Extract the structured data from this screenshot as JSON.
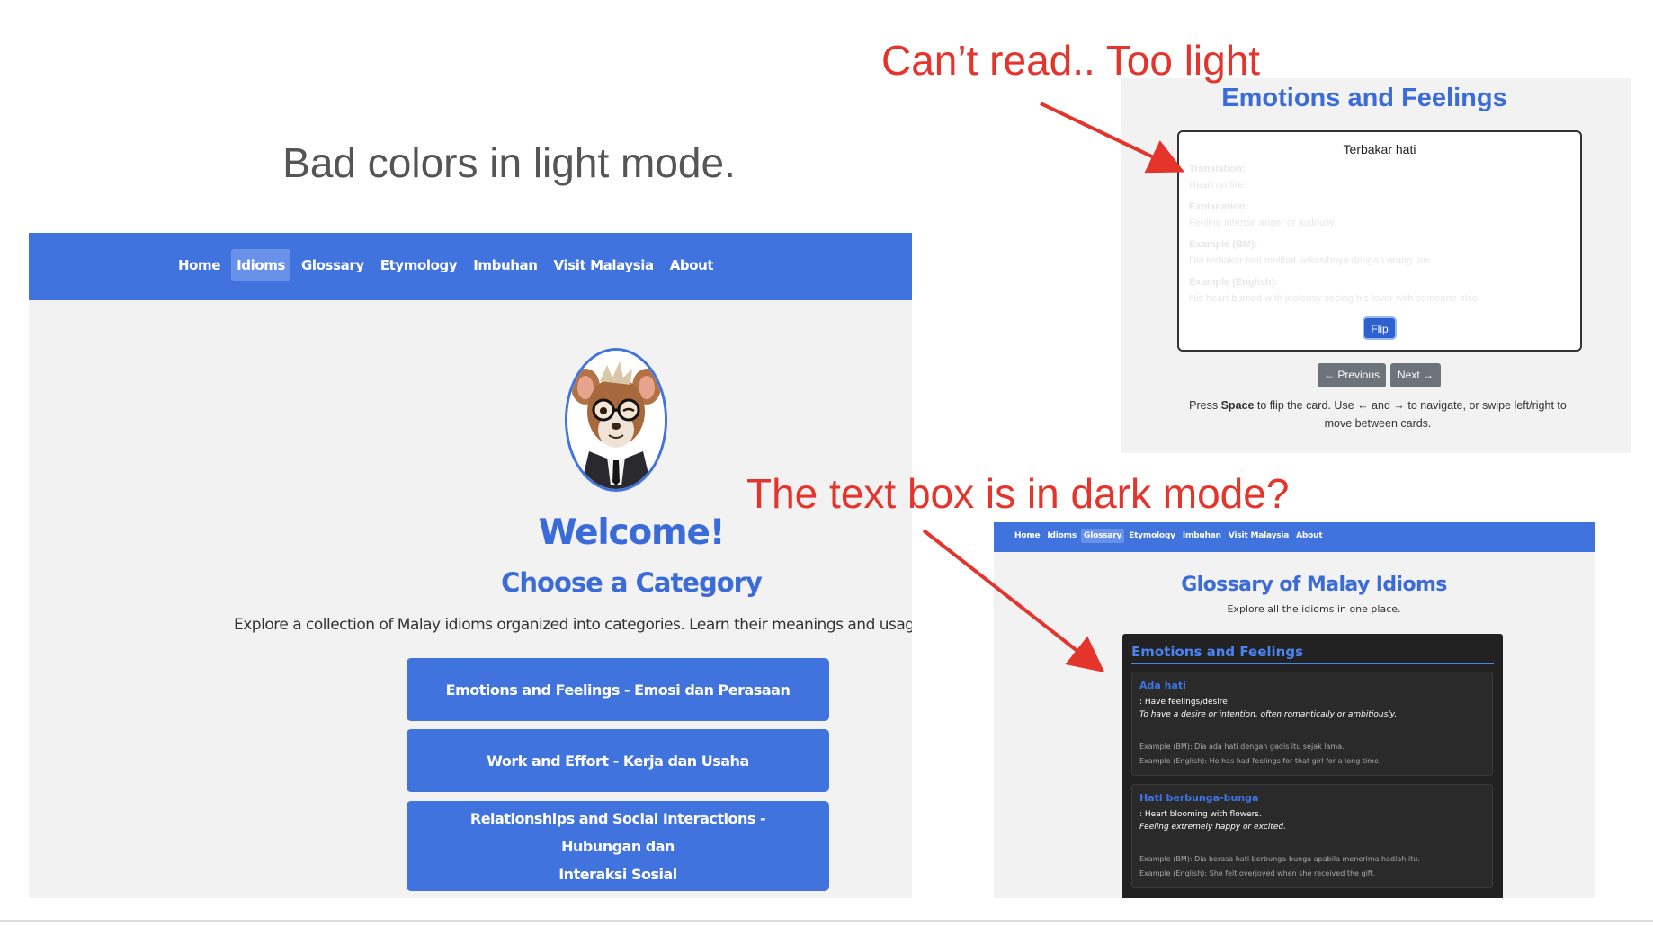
{
  "slide": {
    "title": "Bad colors in light mode."
  },
  "annotations": {
    "top": "Can’t read.. Too light",
    "middle": "The text box is in dark mode?",
    "color": "#e4342b"
  },
  "home_screen": {
    "nav": {
      "items": [
        "Home",
        "Idioms",
        "Glossary",
        "Etymology",
        "Imbuhan",
        "Visit Malaysia",
        "About"
      ],
      "active": "Idioms"
    },
    "mascot": "mouse-mascot-with-glasses",
    "welcome": "Welcome!",
    "choose": "Choose a Category",
    "explore": "Explore a collection of Malay idioms organized into categories. Learn their meanings and usage in a fun and in",
    "categories": [
      {
        "line1": "Emotions and Feelings - Emosi dan Perasaan",
        "line2": ""
      },
      {
        "line1": "Work and Effort - Kerja dan Usaha",
        "line2": ""
      },
      {
        "line1": "Relationships and Social Interactions - Hubungan dan",
        "line2": "Interaksi Sosial"
      }
    ],
    "accent": "#4173df"
  },
  "flashcard_screen": {
    "title": "Emotions and Feelings",
    "card": {
      "word": "Terbakar hati",
      "translation_label": "Translation:",
      "translation": "Heart on fire.",
      "explanation_label": "Explanation:",
      "explanation": "Feeling intense anger or jealousy.",
      "example_bm_label": "Example (BM):",
      "example_bm": "Dia terbakar hati melihat kekasihnya dengan orang lain.",
      "example_en_label": "Example (English):",
      "example_en": "His heart burned with jealousy seeing his lover with someone else.",
      "flip": "Flip"
    },
    "prev": "← Previous",
    "next": "Next →",
    "help_prefix": "Press ",
    "help_key": "Space",
    "help_rest": " to flip the card. Use ← and → to navigate, or swipe left/right to",
    "help_line2": "move between cards."
  },
  "glossary_screen": {
    "nav": {
      "items": [
        "Home",
        "Idioms",
        "Glossary",
        "Etymology",
        "Imbuhan",
        "Visit Malaysia",
        "About"
      ],
      "active": "Glossary"
    },
    "title": "Glossary of Malay Idioms",
    "subtitle": "Explore all the idioms in one place.",
    "section_title": "Emotions and Feelings",
    "entries": [
      {
        "term": "Ada hati",
        "translation": ": Have feelings/desire",
        "explanation": "To have a desire or intention, often romantically or ambitiously.",
        "example_bm": "Example (BM): Dia ada hati dengan gadis itu sejak lama.",
        "example_en": "Example (English): He has had feelings for that girl for a long time."
      },
      {
        "term": "Hati berbunga-bunga",
        "translation": ": Heart blooming with flowers.",
        "explanation": "Feeling extremely happy or excited.",
        "example_bm": "Example (BM): Dia berasa hati berbunga-bunga apabila menerima hadiah itu.",
        "example_en": "Example (English): She felt overjoyed when she received the gift."
      }
    ]
  }
}
